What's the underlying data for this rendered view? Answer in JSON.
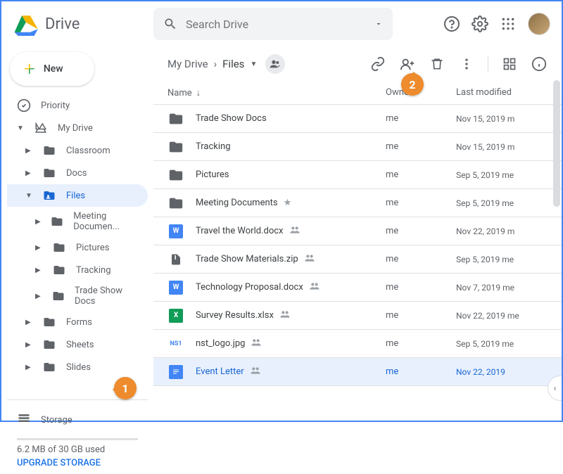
{
  "app_name": "Drive",
  "search": {
    "placeholder": "Search Drive"
  },
  "new_button": "New",
  "sidebar": {
    "priority": "Priority",
    "my_drive": "My Drive",
    "tree": {
      "classroom": "Classroom",
      "docs": "Docs",
      "files": "Files",
      "meeting": "Meeting Documen...",
      "pictures": "Pictures",
      "tracking": "Tracking",
      "trade": "Trade Show Docs",
      "forms": "Forms",
      "sheets": "Sheets",
      "slides": "Slides"
    },
    "storage": {
      "label": "Storage",
      "used": "6.2 MB of 30 GB used",
      "upgrade": "UPGRADE STORAGE"
    }
  },
  "breadcrumb": {
    "root": "My Drive",
    "current": "Files"
  },
  "columns": {
    "name": "Name",
    "owner": "Owner",
    "modified": "Last modified"
  },
  "files": [
    {
      "name": "Trade Show Docs",
      "owner": "me",
      "modified": "Nov 15, 2019",
      "by": "m",
      "type": "folder"
    },
    {
      "name": "Tracking",
      "owner": "me",
      "modified": "Nov 15, 2019",
      "by": "m",
      "type": "folder"
    },
    {
      "name": "Pictures",
      "owner": "me",
      "modified": "Sep 5, 2019",
      "by": "me",
      "type": "folder"
    },
    {
      "name": "Meeting Documents",
      "owner": "me",
      "modified": "Sep 5, 2019",
      "by": "me",
      "type": "folder",
      "starred": true
    },
    {
      "name": "Travel the World.docx",
      "owner": "me",
      "modified": "Nov 22, 2019",
      "by": "m",
      "type": "docx",
      "shared": true
    },
    {
      "name": "Trade Show Materials.zip",
      "owner": "me",
      "modified": "Sep 5, 2019",
      "by": "me",
      "type": "zip",
      "shared": true
    },
    {
      "name": "Technology Proposal.docx",
      "owner": "me",
      "modified": "Nov 7, 2019",
      "by": "me",
      "type": "docx",
      "shared": true
    },
    {
      "name": "Survey Results.xlsx",
      "owner": "me",
      "modified": "Nov 22, 2019",
      "by": "me",
      "type": "xlsx",
      "shared": true
    },
    {
      "name": "nst_logo.jpg",
      "owner": "me",
      "modified": "Sep 5, 2019",
      "by": "me",
      "type": "image",
      "shared": true
    },
    {
      "name": "Event Letter",
      "owner": "me",
      "modified": "Nov 22, 2019",
      "by": "",
      "type": "gdoc",
      "shared": true,
      "selected": true
    }
  ],
  "callouts": {
    "one": "1",
    "two": "2"
  }
}
